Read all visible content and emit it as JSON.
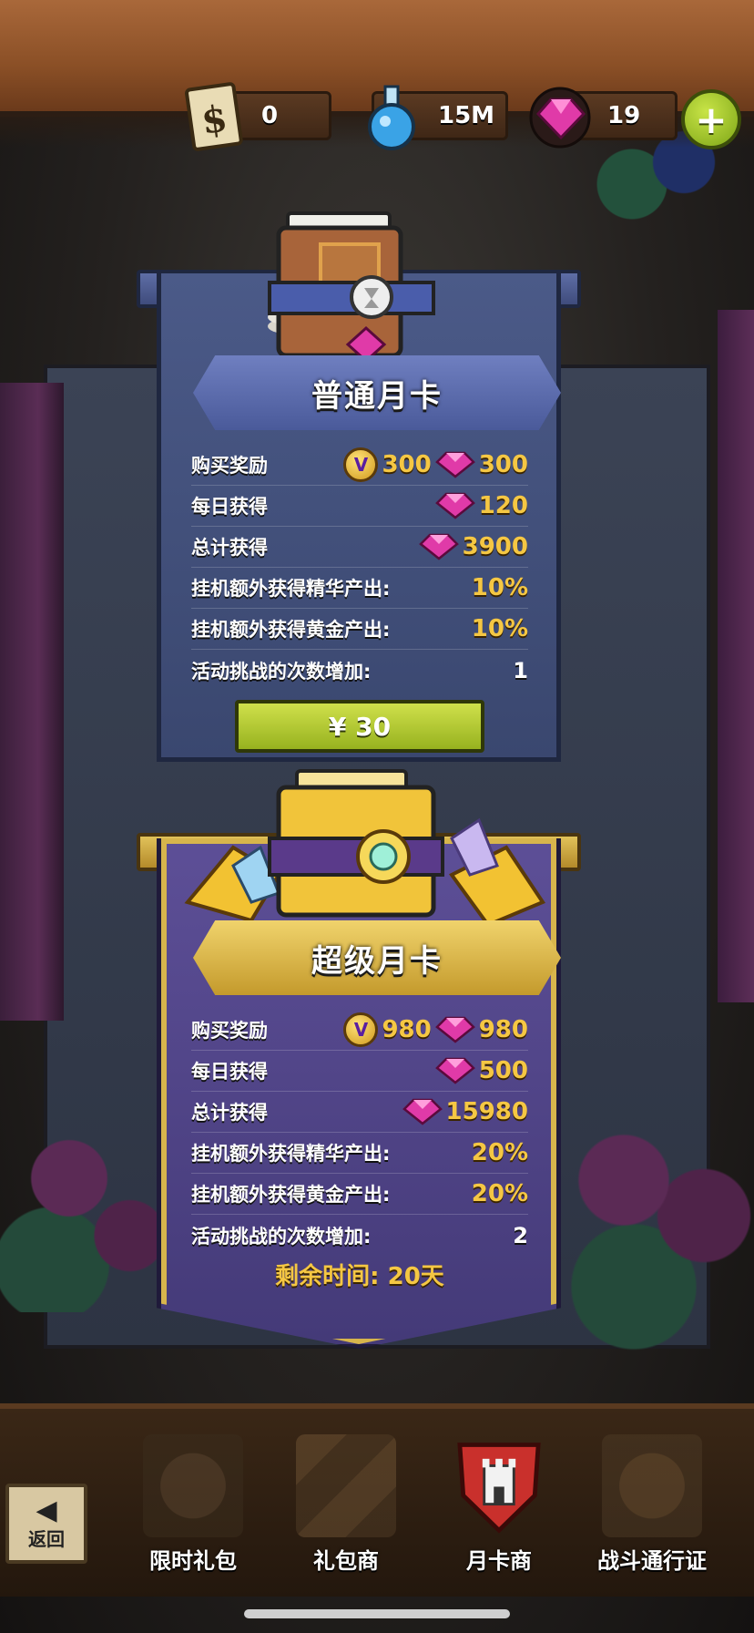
{
  "resources": [
    {
      "icon": "ticket-icon",
      "value": "0"
    },
    {
      "icon": "potion-icon",
      "value": "15M"
    },
    {
      "icon": "gem-icon",
      "value": "19"
    }
  ],
  "plus_label": "+",
  "cards": [
    {
      "title": "普通月卡",
      "rows": [
        {
          "label": "购买奖励",
          "v_value": "300",
          "gem_value": "300"
        },
        {
          "label": "每日获得",
          "gem_value": "120"
        },
        {
          "label": "总计获得",
          "gem_value": "3900"
        },
        {
          "label": "挂机额外获得精华产出:",
          "value": "10%"
        },
        {
          "label": "挂机额外获得黄金产出:",
          "value": "10%"
        },
        {
          "label": "活动挑战的次数增加:",
          "value": "1"
        }
      ],
      "price": "¥ 30"
    },
    {
      "title": "超级月卡",
      "rows": [
        {
          "label": "购买奖励",
          "v_value": "980",
          "gem_value": "980"
        },
        {
          "label": "每日获得",
          "gem_value": "500"
        },
        {
          "label": "总计获得",
          "gem_value": "15980"
        },
        {
          "label": "挂机额外获得精华产出:",
          "value": "20%"
        },
        {
          "label": "挂机额外获得黄金产出:",
          "value": "20%"
        },
        {
          "label": "活动挑战的次数增加:",
          "value": "2"
        }
      ],
      "remaining": "剩余时间: 20天"
    }
  ],
  "v_icon_text": "V",
  "nav": {
    "back": "返回",
    "tabs": [
      "限时礼包",
      "礼包商",
      "月卡商",
      "战斗通行证"
    ],
    "active": "月卡商"
  },
  "colors": {
    "gold": "#f5c743",
    "gem": "#e03aa8",
    "buy": "#a8c42a"
  }
}
